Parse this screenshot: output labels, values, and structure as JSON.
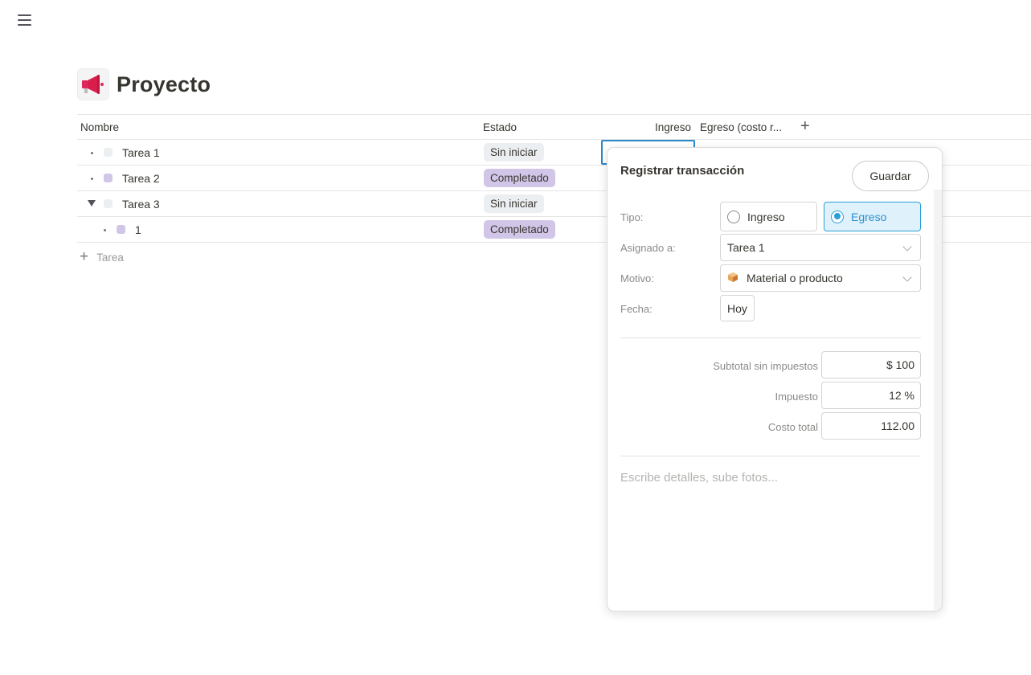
{
  "page": {
    "title": "Proyecto"
  },
  "table": {
    "columns": [
      "Nombre",
      "Estado",
      "Ingreso",
      "Egreso (costo r..."
    ],
    "rows": [
      {
        "name": "Tarea 1",
        "status": "Sin iniciar"
      },
      {
        "name": "Tarea 2",
        "status": "Completado"
      },
      {
        "name": "Tarea 3",
        "status": "Sin iniciar"
      },
      {
        "name": "1",
        "status": "Completado"
      }
    ],
    "add_row_label": "Tarea"
  },
  "popup": {
    "title": "Registrar transacción",
    "save_label": "Guardar",
    "tipo_label": "Tipo:",
    "tipo_options": [
      "Ingreso",
      "Egreso"
    ],
    "tipo_selected": "Egreso",
    "asignado_label": "Asignado a:",
    "asignado_value": "Tarea 1",
    "motivo_label": "Motivo:",
    "motivo_value": "Material o producto",
    "fecha_label": "Fecha:",
    "fecha_value": "Hoy",
    "subtotal_label": "Subtotal sin impuestos",
    "subtotal_value": "$ 100",
    "impuesto_label": "Impuesto",
    "impuesto_value": "12 %",
    "total_label": "Costo total",
    "total_value": "112.00",
    "notes_placeholder": "Escribe detalles, sube fotos..."
  },
  "colors": {
    "accent": "#2b9fd9",
    "badge_gray": "#eceff2",
    "badge_purple": "#d2c6e8"
  },
  "icons": [
    "menu-icon",
    "megaphone-icon",
    "plus-icon",
    "caret-down-icon",
    "chevron-down-icon",
    "box-icon"
  ]
}
